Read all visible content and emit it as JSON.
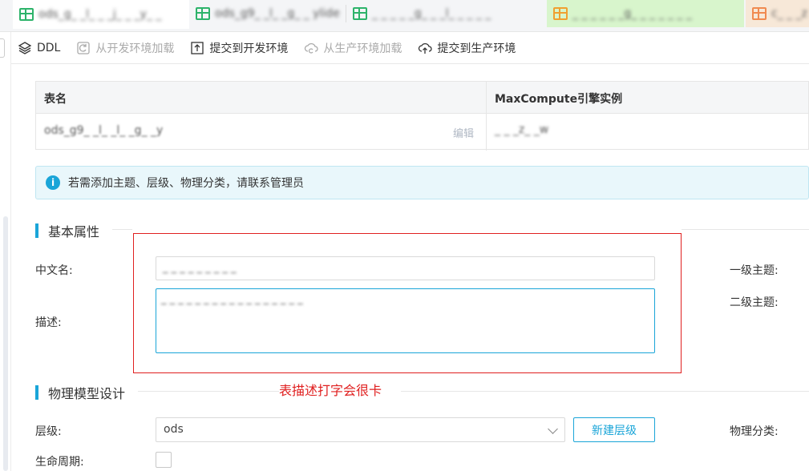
{
  "tabs": [
    {
      "label": "ods_g_ _l_ _ _j_ _ _y_ _"
    },
    {
      "label": "ods_g9_ _l_ _g_ _ ylide"
    },
    {
      "label": "_ _ _ _ _g_ _ _l_ _ _ _ _"
    },
    {
      "label": "_ _ _ _ _ _g_ _ _ _ _ _ _"
    },
    {
      "label": "c_ _ _z"
    }
  ],
  "toolbar": {
    "ddl": "DDL",
    "load_dev": "从开发环境加载",
    "submit_dev": "提交到开发环境",
    "load_prod": "从生产环境加载",
    "submit_prod": "提交到生产环境"
  },
  "table": {
    "col_name": "表名",
    "col_engine": "MaxCompute引擎实例",
    "row_name": "ods_g9_ _l_ _l_ _g_ _y",
    "row_edit": "编辑",
    "row_engine": "_ _ _z_ _w"
  },
  "info": {
    "text": "若需添加主题、层级、物理分类，请联系管理员"
  },
  "basic": {
    "title": "基本属性",
    "cn_name_label": "中文名:",
    "cn_name_value": "_ _ _ _ _ _ _ _ _",
    "desc_label": "描述:",
    "desc_value": "_ _ _ _ _ _ _ _ _ _ _ _ _ _ _ _ _",
    "topic1_label": "一级主题:",
    "topic2_label": "二级主题:",
    "annotation": "表描述打字会很卡"
  },
  "physical": {
    "title": "物理模型设计",
    "layer_label": "层级:",
    "layer_value": "ods",
    "new_layer": "新建层级",
    "category_label": "物理分类:",
    "lifecycle_label": "生命周期:"
  }
}
